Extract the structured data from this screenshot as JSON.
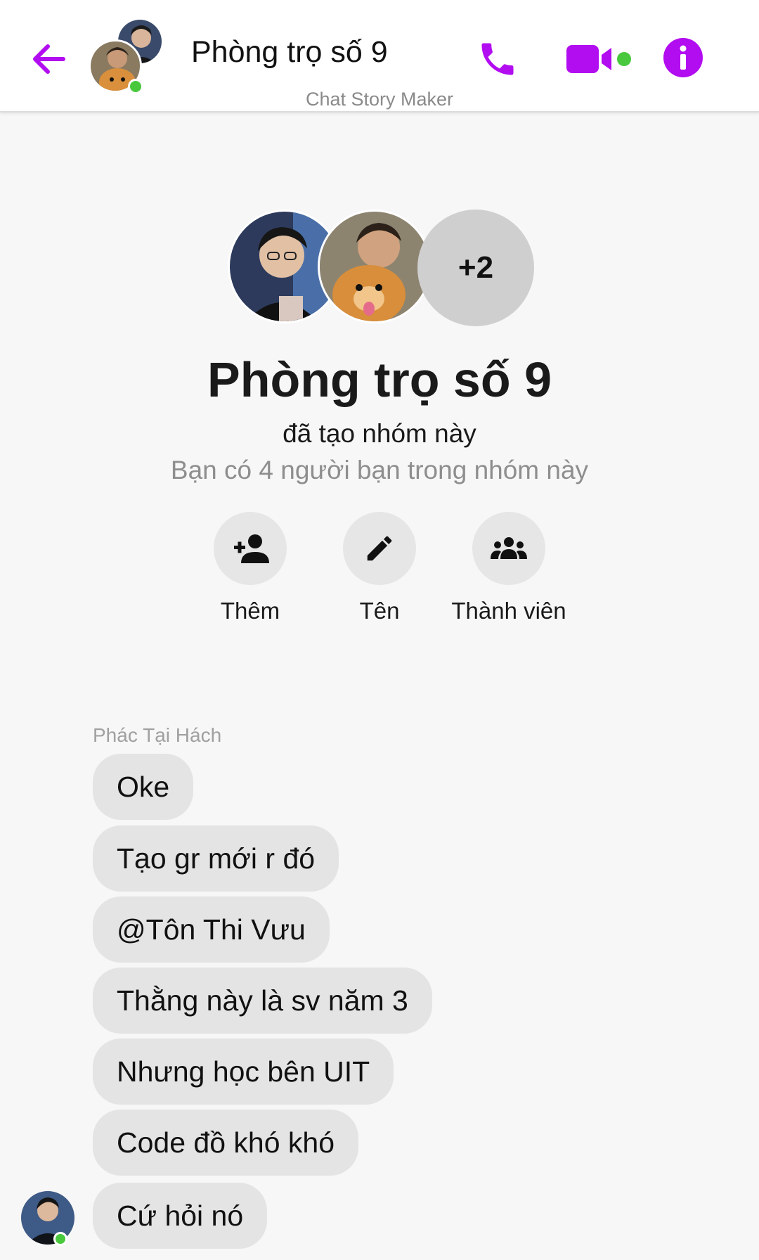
{
  "header": {
    "title": "Phòng trọ số 9",
    "subtitle": "Chat Story Maker",
    "accent_color": "#b20cf0",
    "online_color": "#49c83d",
    "icons": [
      "back-arrow-icon",
      "phone-icon",
      "video-camera-icon",
      "info-icon"
    ]
  },
  "group": {
    "name": "Phòng trọ số 9",
    "created_text": "đã tạo nhóm này",
    "friends_text": "Bạn có 4 người bạn trong nhóm này",
    "more_count": "+2"
  },
  "actions": [
    {
      "label": "Thêm",
      "icon": "add-person-icon"
    },
    {
      "label": "Tên",
      "icon": "pencil-icon"
    },
    {
      "label": "Thành viên",
      "icon": "members-icon"
    }
  ],
  "messages": {
    "sender": "Phác Tại Hách",
    "items": [
      "Oke",
      "Tạo gr mới r đó",
      "@Tôn Thi Vưu",
      "Thằng này là sv năm 3",
      "Nhưng học bên UIT",
      "Code đồ khó khó",
      "Cứ hỏi nó"
    ]
  }
}
